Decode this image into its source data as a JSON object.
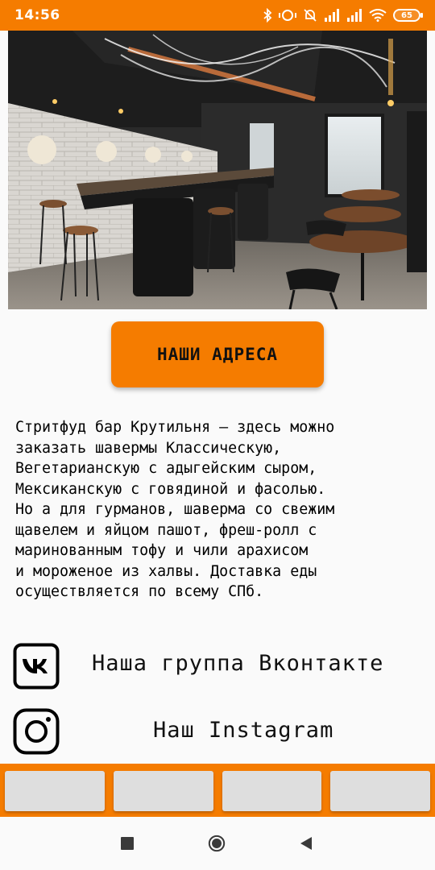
{
  "status_bar": {
    "time": "14:56",
    "battery": "65",
    "icons": [
      "bluetooth-icon",
      "vibrate-icon",
      "mute-icon",
      "signal-icon",
      "signal-icon",
      "wifi-icon",
      "battery-icon"
    ]
  },
  "colors": {
    "accent": "#f57c00",
    "tab_button": "#dedede",
    "background": "#fafafa"
  },
  "hero": {
    "image": "bar-interior-photo"
  },
  "main": {
    "addresses_button": "НАШИ АДРЕСА",
    "description": "Стритфуд бар Крутильня — здесь можно\nзаказать шавермы Классическую,\nВегетарианскую с адыгейским сыром,\nМексиканскую с говядиной и фасолью.\nНо а для гурманов, шаверма со свежим\nщавелем и яйцом пашот, фреш-ролл с\nмаринованным тофу и чили арахисом\nи мороженое из халвы. Доставка еды\nосуществляется по всему СПб."
  },
  "social": {
    "vk_label": "Наша группа Вконтакте",
    "vk_icon": "vk-icon",
    "instagram_label": "Наш Instagram",
    "instagram_icon": "instagram-icon"
  },
  "tab_bar": {
    "buttons": [
      "",
      "",
      "",
      ""
    ]
  },
  "nav_bar": {
    "buttons": [
      "recents-icon",
      "home-icon",
      "back-icon"
    ]
  }
}
